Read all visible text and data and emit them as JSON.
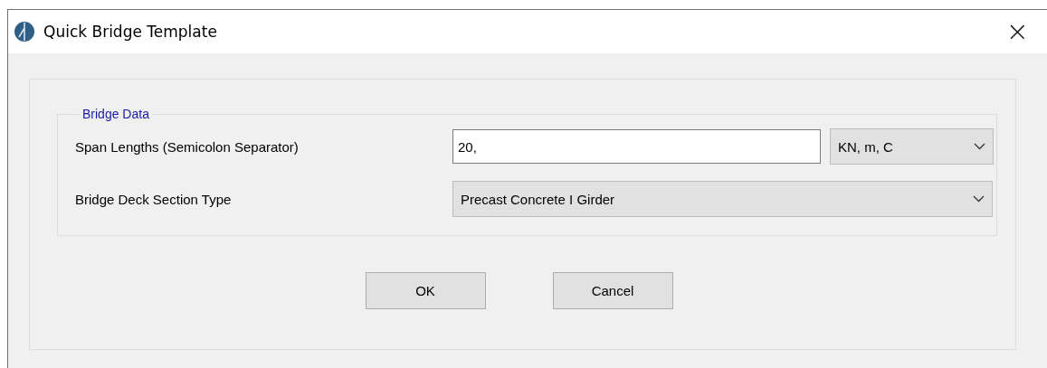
{
  "window": {
    "title": "Quick Bridge Template",
    "close": "×"
  },
  "group": {
    "title": "Bridge Data"
  },
  "rows": [
    {
      "kind": "text",
      "label": "Span Lengths  (Semicolon Separator)",
      "value": "20,",
      "units": "KN, m, C"
    },
    {
      "kind": "select",
      "label": "Bridge Deck Section Type",
      "value": "Precast Concrete I Girder"
    }
  ],
  "buttons": [
    "OK",
    "Cancel"
  ]
}
